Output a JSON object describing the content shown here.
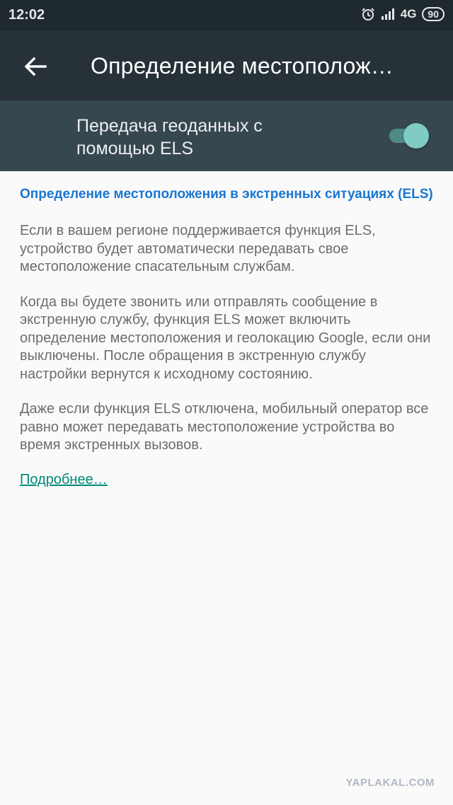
{
  "status_bar": {
    "time": "12:02",
    "network": "4G",
    "battery": "90",
    "icons": [
      "alarm-icon",
      "signal-icon"
    ]
  },
  "app_bar": {
    "back_icon": "arrow-left-icon",
    "title": "Определение местополож…"
  },
  "toggle": {
    "label": "Передача геоданных с помощью ELS",
    "state": "on",
    "accent_color": "#80cbc4"
  },
  "content": {
    "title": "Определение местоположения в экстренных ситуациях (ELS)",
    "paragraphs": [
      "Если в вашем регионе поддерживается функция ELS, устройство будет автоматически передавать свое местоположение спасательным службам.",
      "Когда вы будете звонить или отправлять сообщение в экстренную службу, функция ELS может включить определение местоположения и геолокацию Google, если они выключены. После обращения в экстренную службу настройки вернутся к исходному состоянию.",
      "Даже если функция ELS отключена, мобильный оператор все равно может передавать местоположение устройства во время экстренных вызовов."
    ],
    "more_link": "Подробнее…"
  },
  "watermark": "YAPLAKAL.COM",
  "colors": {
    "app_bar": "#263238",
    "toggle_row": "#37474f",
    "title_blue": "#1976d2",
    "link_teal": "#00897b"
  }
}
